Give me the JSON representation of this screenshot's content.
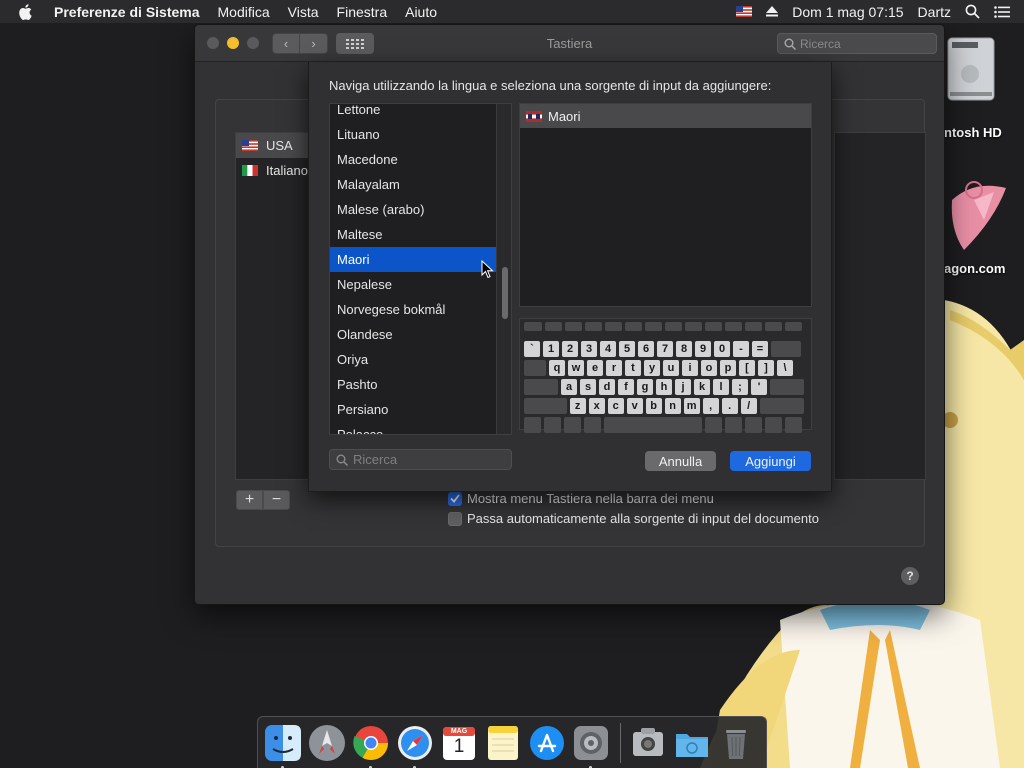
{
  "menubar": {
    "app_name": "Preferenze di Sistema",
    "menus": [
      "Modifica",
      "Vista",
      "Finestra",
      "Aiuto"
    ],
    "datetime": "Dom 1 mag  07:15",
    "user": "Dartz"
  },
  "desktop": {
    "disk_label": "ntosh HD",
    "site_label": "agon.com"
  },
  "window": {
    "title": "Tastiera",
    "search_placeholder": "Ricerca",
    "input_sources": [
      {
        "label": "USA",
        "flag": "us"
      },
      {
        "label": "Italiano",
        "flag": "it"
      }
    ],
    "show_menu_label": "Mostra menu Tastiera nella barra dei menu",
    "show_menu_checked": true,
    "auto_switch_label": "Passa automaticamente alla sorgente di input del documento",
    "auto_switch_checked": false,
    "help_label": "?"
  },
  "sheet": {
    "prompt": "Naviga utilizzando la lingua e seleziona una sorgente di input da aggiungere:",
    "languages": [
      "Lettone",
      "Lituano",
      "Macedone",
      "Malayalam",
      "Malese (arabo)",
      "Maltese",
      "Maori",
      "Nepalese",
      "Norvegese bokmål",
      "Olandese",
      "Oriya",
      "Pashto",
      "Persiano",
      "Polacco"
    ],
    "selected_language": "Maori",
    "source_selected": "Maori",
    "search_placeholder": "Ricerca",
    "cancel_label": "Annulla",
    "add_label": "Aggiungi",
    "keyboard_rows": [
      [
        "`",
        "1",
        "2",
        "3",
        "4",
        "5",
        "6",
        "7",
        "8",
        "9",
        "0",
        "-",
        "="
      ],
      [
        "q",
        "w",
        "e",
        "r",
        "t",
        "y",
        "u",
        "i",
        "o",
        "p",
        "[",
        "]",
        "\\"
      ],
      [
        "a",
        "s",
        "d",
        "f",
        "g",
        "h",
        "j",
        "k",
        "l",
        ";",
        "'"
      ],
      [
        "z",
        "x",
        "c",
        "v",
        "b",
        "n",
        "m",
        ",",
        ".",
        "/"
      ]
    ]
  },
  "dock": {
    "apps": [
      "finder-icon",
      "launchpad-icon",
      "chrome-icon",
      "safari-icon",
      "calendar-icon",
      "notes-icon",
      "app-store-icon",
      "system-preferences-icon"
    ],
    "calendar_month": "MAG",
    "calendar_day": "1"
  },
  "colors": {
    "accent": "#0b55c9",
    "button_primary": "#1e69e0",
    "checkbox_on": "#2a6ee6"
  }
}
